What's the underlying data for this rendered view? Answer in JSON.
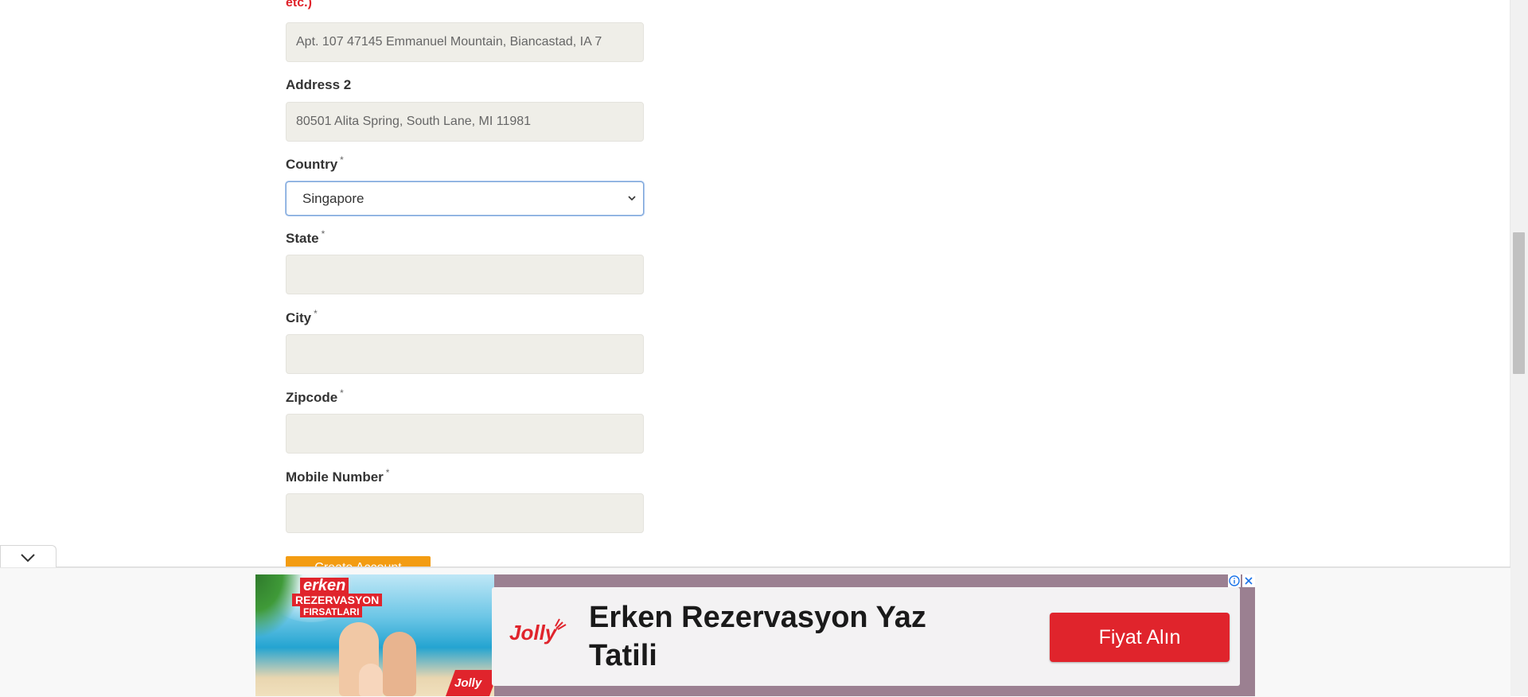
{
  "form": {
    "prev_label_fragment": "etc.)",
    "address1_value": "Apt. 107 47145 Emmanuel Mountain, Biancastad, IA 7",
    "address2_label": "Address 2",
    "address2_value": "80501 Alita Spring, South Lane, MI 11981",
    "country_label": "Country",
    "country_value": "Singapore",
    "state_label": "State",
    "state_value": "",
    "city_label": "City",
    "city_value": "",
    "zipcode_label": "Zipcode",
    "zipcode_value": "",
    "mobile_label": "Mobile Number",
    "mobile_value": "",
    "required_mark": "*",
    "submit_label": "Create Account"
  },
  "ad": {
    "badge_line1": "erken",
    "badge_line2": "REZERVASYON",
    "badge_line3": "FIRSATLARI",
    "corner_brand": "Jolly",
    "brand": "Jolly",
    "headline": "Erken Rezervasyon Yaz Tatili",
    "cta": "Fiyat Alın",
    "info_icon": "info-icon",
    "close_icon": "close-icon",
    "brand_color": "#e0242c"
  },
  "colors": {
    "input_bg": "#efeee8",
    "submit_bg": "#f39c12",
    "error_red": "#e0242c"
  }
}
